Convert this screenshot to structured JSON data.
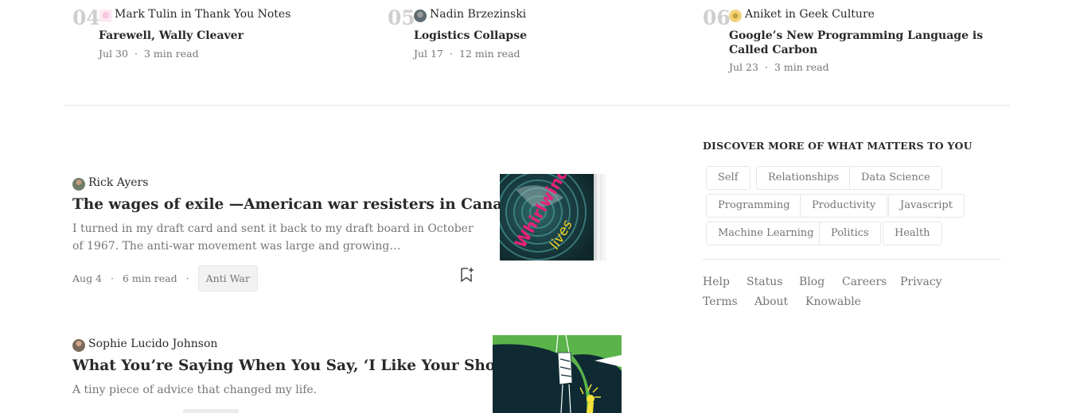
{
  "trending": [
    {
      "number": "04",
      "author": "Mark Tulin",
      "in_word": "in",
      "publication": "Thank You Notes",
      "title": "Farewell, Wally Cleaver",
      "date": "Jul 30",
      "read_time": "3 min read",
      "dot": "·"
    },
    {
      "number": "05",
      "author": "Nadin Brzezinski",
      "in_word": "",
      "publication": "",
      "title": "Logistics Collapse",
      "date": "Jul 17",
      "read_time": "12 min read",
      "dot": "·"
    },
    {
      "number": "06",
      "author": "Aniket",
      "in_word": "in",
      "publication": "Geek Culture",
      "title": "Google’s New Programming Language is Called Carbon",
      "date": "Jul 23",
      "read_time": "3 min read",
      "dot": "·"
    }
  ],
  "feed": [
    {
      "author": "Rick Ayers",
      "title": "The wages of exile —American war resisters in Canada",
      "snippet": "I turned in my draft card and sent it back to my draft board in October of 1967. The anti-war movement was large and growing…",
      "date": "Aug 4",
      "read_time": "6 min read",
      "tag": "Anti War",
      "dot": "·",
      "thumb_text": "My Whirlwind Lives"
    },
    {
      "author": "Sophie Lucido Johnson",
      "title": "What You’re Saying When You Say, ‘I Like Your Shoes’",
      "snippet": "A tiny piece of advice that changed my life."
    }
  ],
  "sidebar": {
    "heading": "DISCOVER MORE OF WHAT MATTERS TO YOU",
    "topics": [
      "Self",
      "Relationships",
      "Data Science",
      "Programming",
      "Productivity",
      "Javascript",
      "Machine Learning",
      "Politics",
      "Health"
    ],
    "footer_links": [
      "Help",
      "Status",
      "Blog",
      "Careers",
      "Privacy",
      "Terms",
      "About",
      "Knowable"
    ]
  },
  "colors": {
    "number_gray": "#cfcfcf",
    "text_primary": "#292929",
    "text_secondary": "#757575",
    "divider": "#e6e6e6"
  },
  "icons": {
    "bookmark": "bookmark-add-icon"
  }
}
